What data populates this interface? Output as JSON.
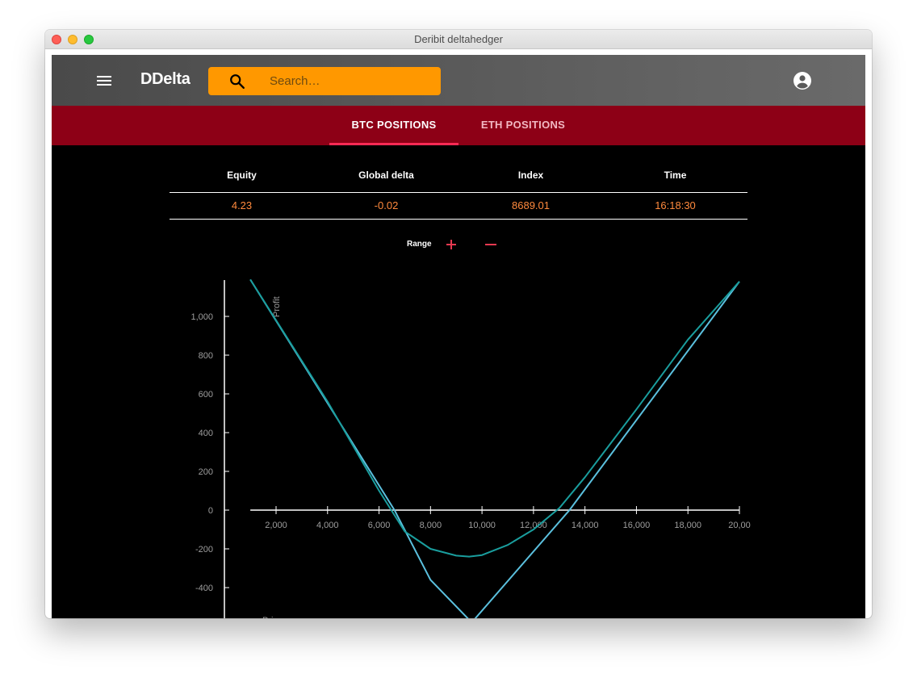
{
  "window": {
    "title": "Deribit deltahedger"
  },
  "appbar": {
    "brand": "DDelta",
    "search_placeholder": "Search…",
    "icons": [
      "menu-icon",
      "search-icon",
      "account-circle-icon"
    ]
  },
  "tabs": [
    {
      "label": "BTC POSITIONS",
      "active": true
    },
    {
      "label": "ETH POSITIONS",
      "active": false
    }
  ],
  "stats": {
    "headers": [
      "Equity",
      "Global delta",
      "Index",
      "Time"
    ],
    "values": [
      "4.23",
      "-0.02",
      "8689.01",
      "16:18:30"
    ]
  },
  "range": {
    "label": "Range"
  },
  "colors": {
    "accent": "#ff9800",
    "tab_bar": "#8d0016",
    "value_text": "#ff8a3d",
    "range_controls": "#e53950"
  },
  "chart_data": {
    "type": "line",
    "ylabel": "Profit",
    "xlabel": "Price",
    "xlim": [
      1000,
      20000
    ],
    "ylim": [
      -580,
      1200
    ],
    "x_ticks": [
      2000,
      4000,
      6000,
      8000,
      10000,
      12000,
      14000,
      16000,
      18000,
      20000
    ],
    "x_tick_labels": [
      "2,000",
      "4,000",
      "6,000",
      "8,000",
      "10,000",
      "12,000",
      "14,000",
      "16,000",
      "18,000",
      "20,00"
    ],
    "y_ticks": [
      1000,
      800,
      600,
      400,
      200,
      0,
      -200,
      -400
    ],
    "y_tick_labels": [
      "1,000",
      "800",
      "600",
      "400",
      "200",
      "0",
      "-200",
      "-400"
    ],
    "series": [
      {
        "color": "#5bc0de",
        "x": [
          1000,
          6600,
          8000,
          9600,
          13400,
          20000
        ],
        "y": [
          1190,
          0,
          -360,
          -580,
          0,
          1180
        ]
      },
      {
        "color": "#1a9e9e",
        "x": [
          1000,
          4000,
          6000,
          7000,
          8000,
          9000,
          9500,
          10000,
          11000,
          12000,
          13000,
          14000,
          16000,
          18000,
          20000
        ],
        "y": [
          1190,
          560,
          100,
          -110,
          -200,
          -235,
          -240,
          -232,
          -180,
          -100,
          10,
          170,
          520,
          880,
          1180
        ]
      }
    ]
  }
}
